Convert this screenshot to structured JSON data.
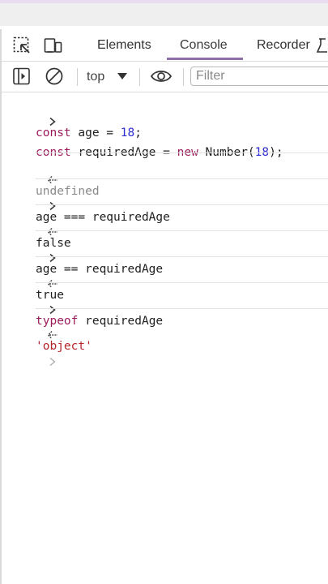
{
  "tabs": [
    "Elements",
    "Console",
    "Recorder"
  ],
  "toolbar": {
    "context": "top",
    "filter_placeholder": "Filter"
  },
  "console": {
    "input1_line1": [
      "const",
      " age = ",
      "18",
      ";"
    ],
    "input1_line2": [
      "const",
      " requiredAge = ",
      "new",
      " Number(",
      "18",
      ");"
    ],
    "output1": "undefined",
    "input2": "age === requiredAge",
    "output2": "false",
    "input3": "age == requiredAge",
    "output3": "true",
    "input4": [
      "typeof",
      " requiredAge"
    ],
    "output4": "'object'"
  },
  "icons": [
    "inspect-element-icon",
    "device-toggle-icon",
    "recorder-flask-icon",
    "sidebar-toggle-icon",
    "clear-console-icon",
    "dropdown-arrow-icon",
    "live-expression-eye-icon",
    "input-prompt-icon",
    "output-prompt-icon"
  ]
}
